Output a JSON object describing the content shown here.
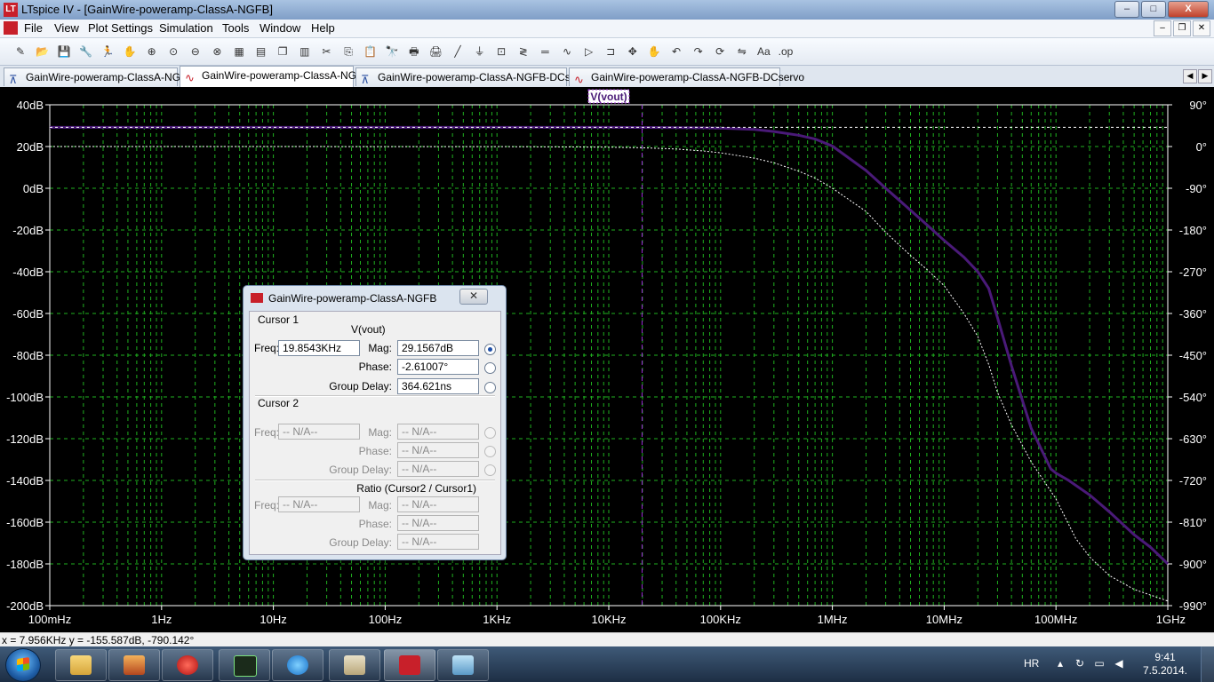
{
  "window": {
    "title": "LTspice IV - [GainWire-poweramp-ClassA-NGFB]",
    "app_icon_label": "LT"
  },
  "window_buttons": {
    "minimize": "–",
    "maximize": "□",
    "close": "X"
  },
  "menu": [
    "File",
    "View",
    "Plot Settings",
    "Simulation",
    "Tools",
    "Window",
    "Help"
  ],
  "mdi_buttons": [
    "–",
    "❐",
    "✕"
  ],
  "toolbar_icons": [
    "new-schematic-icon",
    "open-icon",
    "save-icon",
    "control-panel-icon",
    "run-icon",
    "halt-icon",
    "zoom-in-icon",
    "zoom-fit-icon",
    "zoom-out-icon",
    "zoom-cancel-icon",
    "autorange-icon",
    "tile-horizontal-icon",
    "cascade-icon",
    "tile-vertical-icon",
    "cut-icon",
    "copy-icon",
    "paste-icon",
    "find-icon",
    "print-preview-icon",
    "print-icon",
    "wire-icon",
    "ground-icon",
    "label-icon",
    "resistor-icon",
    "capacitor-icon",
    "inductor-icon",
    "diode-icon",
    "component-icon",
    "move-icon",
    "drag-icon",
    "undo-icon",
    "redo-icon",
    "rotate-icon",
    "mirror-icon",
    "text-icon",
    "spice-directive-icon"
  ],
  "tabs": [
    {
      "label": "GainWire-poweramp-ClassA-NGFB",
      "kind": "schematic"
    },
    {
      "label": "GainWire-poweramp-ClassA-NGFB",
      "kind": "waveform"
    },
    {
      "label": "GainWire-poweramp-ClassA-NGFB-DCservo",
      "kind": "schematic"
    },
    {
      "label": "GainWire-poweramp-ClassA-NGFB-DCservo",
      "kind": "waveform"
    }
  ],
  "trace_label": "V(vout)",
  "chart_data": {
    "type": "line",
    "x_ticks": [
      "100mHz",
      "1Hz",
      "10Hz",
      "100Hz",
      "1KHz",
      "10KHz",
      "100KHz",
      "1MHz",
      "10MHz",
      "100MHz",
      "1GHz"
    ],
    "y_left_ticks": [
      "40dB",
      "20dB",
      "0dB",
      "-20dB",
      "-40dB",
      "-60dB",
      "-80dB",
      "-100dB",
      "-120dB",
      "-140dB",
      "-160dB",
      "-180dB",
      "-200dB"
    ],
    "y_right_ticks": [
      "90°",
      "0°",
      "-90°",
      "-180°",
      "-270°",
      "-360°",
      "-450°",
      "-540°",
      "-630°",
      "-720°",
      "-810°",
      "-900°",
      "-990°"
    ],
    "x_scale": "log",
    "xlim_hz": [
      0.1,
      1000000000
    ],
    "ylim_db": [
      -200,
      40
    ],
    "ylim_deg": [
      -990,
      90
    ],
    "grid": true,
    "cursor1_hz": 19854.3,
    "series": [
      {
        "name": "V(vout)",
        "unit": "dB",
        "x": [
          0.1,
          1000,
          10000,
          30000,
          60000,
          100000,
          200000,
          300000,
          500000,
          700000,
          1000000,
          2000000,
          3000000,
          5000000,
          7000000,
          10000000,
          15000000,
          20000000,
          25000000,
          30000000,
          40000000,
          60000000,
          90000000,
          100000000,
          130000000,
          200000000,
          300000000,
          500000000,
          700000000,
          1000000000
        ],
        "values": [
          29.2,
          29.2,
          29.2,
          29.1,
          29.0,
          28.8,
          28.2,
          27.2,
          25.4,
          23.6,
          20.2,
          8.5,
          0.0,
          -10.5,
          -17.5,
          -25.0,
          -33.0,
          -40.0,
          -48.0,
          -62.0,
          -85.0,
          -115.0,
          -134.5,
          -136.5,
          -140.0,
          -147.0,
          -155.0,
          -166.0,
          -172.0,
          -180.0
        ]
      },
      {
        "name": "V(vout)",
        "unit": "deg",
        "x": [
          0.1,
          1000,
          10000,
          20000,
          40000,
          70000,
          100000,
          200000,
          300000,
          500000,
          700000,
          1000000,
          2000000,
          3000000,
          5000000,
          7000000,
          10000000,
          15000000,
          20000000,
          25000000,
          30000000,
          40000000,
          60000000,
          100000000,
          150000000,
          200000000,
          300000000,
          500000000,
          1000000000
        ],
        "values": [
          0.0,
          -0.1,
          -1.3,
          -2.6,
          -5.3,
          -9.5,
          -13.5,
          -25.0,
          -35.0,
          -53.0,
          -68.0,
          -90.0,
          -140.0,
          -185.0,
          -235.0,
          -265.0,
          -300.0,
          -360.0,
          -410.0,
          -470.0,
          -530.0,
          -600.0,
          -680.0,
          -760.0,
          -845.0,
          -885.0,
          -925.0,
          -955.0,
          -980.0
        ]
      }
    ]
  },
  "cursor_dialog": {
    "title": "GainWire-poweramp-ClassA-NGFB",
    "cursor1_label": "Cursor 1",
    "trace": "V(vout)",
    "freq_label": "Freq:",
    "freq": "19.8543KHz",
    "mag_label": "Mag:",
    "mag": "29.1567dB",
    "phase_label": "Phase:",
    "phase": "-2.61007°",
    "gd_label": "Group Delay:",
    "gd": "364.621ns",
    "cursor2_label": "Cursor 2",
    "na": "-- N/A--",
    "ratio_label": "Ratio (Cursor2 / Cursor1)"
  },
  "status": {
    "text": "x = 7.956KHz   y = -155.587dB, -790.142°"
  },
  "tray": {
    "lang": "HR",
    "time": "9:41",
    "date": "7.5.2014."
  }
}
